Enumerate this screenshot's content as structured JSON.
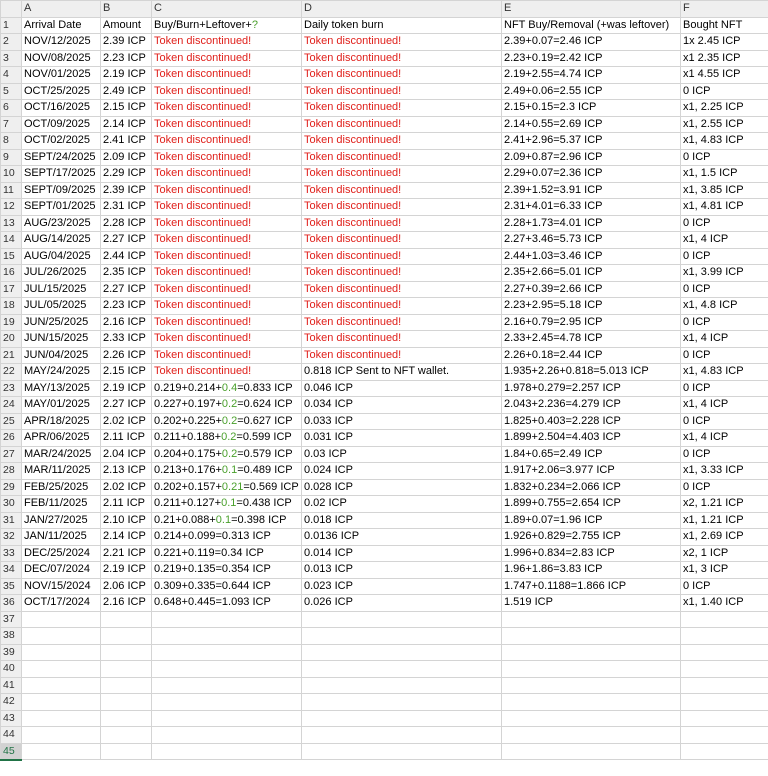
{
  "colors": {
    "discontinued": "#e0201b",
    "highlight_number": "#4aa02c",
    "active_row_header": "#217346"
  },
  "columns": [
    "A",
    "B",
    "C",
    "D",
    "E",
    "F"
  ],
  "headers": {
    "a": "Arrival Date",
    "b": "Amount",
    "c_pre": "Buy/Burn+Leftover+",
    "c_q": "?",
    "d": "Daily token burn",
    "e": "NFT Buy/Removal (+was leftover)",
    "f": "Bought NFT"
  },
  "rows": [
    {
      "a": "NOV/12/2025",
      "b": "2.39 ICP",
      "c": "Token discontinued!",
      "c_red": true,
      "d": "Token discontinued!",
      "d_red": true,
      "e": "2.39+0.07=2.46 ICP",
      "f": "1x 2.45 ICP"
    },
    {
      "a": "NOV/08/2025",
      "b": "2.23 ICP",
      "c": "Token discontinued!",
      "c_red": true,
      "d": "Token discontinued!",
      "d_red": true,
      "e": "2.23+0.19=2.42 ICP",
      "f": "x1 2.35 ICP"
    },
    {
      "a": "NOV/01/2025",
      "b": "2.19 ICP",
      "c": "Token discontinued!",
      "c_red": true,
      "d": "Token discontinued!",
      "d_red": true,
      "e": "2.19+2.55=4.74 ICP",
      "f": "x1 4.55 ICP"
    },
    {
      "a": "OCT/25/2025",
      "b": "2.49 ICP",
      "c": "Token discontinued!",
      "c_red": true,
      "d": "Token discontinued!",
      "d_red": true,
      "e": "2.49+0.06=2.55 ICP",
      "f": "0 ICP"
    },
    {
      "a": "OCT/16/2025",
      "b": "2.15 ICP",
      "c": "Token discontinued!",
      "c_red": true,
      "d": "Token discontinued!",
      "d_red": true,
      "e": "2.15+0.15=2.3 ICP",
      "f": "x1, 2.25 ICP"
    },
    {
      "a": "OCT/09/2025",
      "b": "2.14 ICP",
      "c": "Token discontinued!",
      "c_red": true,
      "d": "Token discontinued!",
      "d_red": true,
      "e": "2.14+0.55=2.69 ICP",
      "f": "x1, 2.55 ICP"
    },
    {
      "a": "OCT/02/2025",
      "b": "2.41 ICP",
      "c": "Token discontinued!",
      "c_red": true,
      "d": "Token discontinued!",
      "d_red": true,
      "e": "2.41+2.96=5.37 ICP",
      "f": "x1, 4.83 ICP"
    },
    {
      "a": "SEPT/24/2025",
      "b": "2.09 ICP",
      "c": "Token discontinued!",
      "c_red": true,
      "d": "Token discontinued!",
      "d_red": true,
      "e": "2.09+0.87=2.96 ICP",
      "f": "0 ICP"
    },
    {
      "a": "SEPT/17/2025",
      "b": "2.29 ICP",
      "c": "Token discontinued!",
      "c_red": true,
      "d": "Token discontinued!",
      "d_red": true,
      "e": "2.29+0.07=2.36 ICP",
      "f": "x1, 1.5 ICP"
    },
    {
      "a": "SEPT/09/2025",
      "b": "2.39 ICP",
      "c": "Token discontinued!",
      "c_red": true,
      "d": "Token discontinued!",
      "d_red": true,
      "e": "2.39+1.52=3.91 ICP",
      "f": "x1, 3.85 ICP"
    },
    {
      "a": "SEPT/01/2025",
      "b": "2.31 ICP",
      "c": "Token discontinued!",
      "c_red": true,
      "d": "Token discontinued!",
      "d_red": true,
      "e": "2.31+4.01=6.33 ICP",
      "f": "x1, 4.81 ICP"
    },
    {
      "a": "AUG/23/2025",
      "b": "2.28 ICP",
      "c": "Token discontinued!",
      "c_red": true,
      "d": "Token discontinued!",
      "d_red": true,
      "e": "2.28+1.73=4.01 ICP",
      "f": "0 ICP"
    },
    {
      "a": "AUG/14/2025",
      "b": "2.27 ICP",
      "c": "Token discontinued!",
      "c_red": true,
      "d": "Token discontinued!",
      "d_red": true,
      "e": "2.27+3.46=5.73 ICP",
      "f": "x1, 4 ICP"
    },
    {
      "a": "AUG/04/2025",
      "b": "2.44 ICP",
      "c": "Token discontinued!",
      "c_red": true,
      "d": "Token discontinued!",
      "d_red": true,
      "e": "2.44+1.03=3.46 ICP",
      "f": "0 ICP"
    },
    {
      "a": "JUL/26/2025",
      "b": "2.35 ICP",
      "c": "Token discontinued!",
      "c_red": true,
      "d": "Token discontinued!",
      "d_red": true,
      "e": "2.35+2.66=5.01 ICP",
      "f": "x1, 3.99 ICP"
    },
    {
      "a": "JUL/15/2025",
      "b": "2.27 ICP",
      "c": "Token discontinued!",
      "c_red": true,
      "d": "Token discontinued!",
      "d_red": true,
      "e": "2.27+0.39=2.66 ICP",
      "f": "0 ICP"
    },
    {
      "a": "JUL/05/2025",
      "b": "2.23 ICP",
      "c": "Token discontinued!",
      "c_red": true,
      "d": "Token discontinued!",
      "d_red": true,
      "e": "2.23+2.95=5.18 ICP",
      "f": "x1, 4.8 ICP"
    },
    {
      "a": "JUN/25/2025",
      "b": "2.16 ICP",
      "c": "Token discontinued!",
      "c_red": true,
      "d": "Token discontinued!",
      "d_red": true,
      "e": "2.16+0.79=2.95 ICP",
      "f": "0 ICP"
    },
    {
      "a": "JUN/15/2025",
      "b": "2.33 ICP",
      "c": "Token discontinued!",
      "c_red": true,
      "d": "Token discontinued!",
      "d_red": true,
      "e": "2.33+2.45=4.78 ICP",
      "f": "x1, 4 ICP"
    },
    {
      "a": "JUN/04/2025",
      "b": "2.26 ICP",
      "c": "Token discontinued!",
      "c_red": true,
      "d": "Token discontinued!",
      "d_red": true,
      "e": "2.26+0.18=2.44 ICP",
      "f": "0 ICP"
    },
    {
      "a": "MAY/24/2025",
      "b": "2.15 ICP",
      "c": "Token discontinued!",
      "c_red": true,
      "d": "0.818 ICP Sent to NFT wallet.",
      "e": "1.935+2.26+0.818=5.013 ICP",
      "f": "x1, 4.83 ICP"
    },
    {
      "a": "MAY/13/2025",
      "b": "2.19 ICP",
      "c_parts": [
        "0.219+0.214+",
        "0.4",
        "=0.833 ICP"
      ],
      "d": "0.046 ICP",
      "e": "1.978+0.279=2.257 ICP",
      "f": "0 ICP"
    },
    {
      "a": "MAY/01/2025",
      "b": "2.27 ICP",
      "c_parts": [
        "0.227+0.197+",
        "0.2",
        "=0.624 ICP"
      ],
      "d": "0.034 ICP",
      "e": "2.043+2.236=4.279 ICP",
      "f": "x1, 4 ICP"
    },
    {
      "a": "APR/18/2025",
      "b": "2.02 ICP",
      "c_parts": [
        "0.202+0.225+",
        "0.2",
        "=0.627 ICP"
      ],
      "d": "0.033 ICP",
      "e": "1.825+0.403=2.228 ICP",
      "f": "0 ICP"
    },
    {
      "a": "APR/06/2025",
      "b": "2.11 ICP",
      "c_parts": [
        "0.211+0.188+",
        "0.2",
        "=0.599 ICP"
      ],
      "d": "0.031 ICP",
      "e": "1.899+2.504=4.403 ICP",
      "f": "x1, 4 ICP"
    },
    {
      "a": "MAR/24/2025",
      "b": "2.04 ICP",
      "c_parts": [
        "0.204+0.175+",
        "0.2",
        "=0.579 ICP"
      ],
      "d": "0.03 ICP",
      "e": "1.84+0.65=2.49 ICP",
      "f": "0 ICP"
    },
    {
      "a": "MAR/11/2025",
      "b": "2.13 ICP",
      "c_parts": [
        "0.213+0.176+",
        "0.1",
        "=0.489 ICP"
      ],
      "d": "0.024 ICP",
      "e": "1.917+2.06=3.977 ICP",
      "f": "x1, 3.33 ICP"
    },
    {
      "a": "FEB/25/2025",
      "b": "2.02 ICP",
      "c_parts": [
        "0.202+0.157+",
        "0.21",
        "=0.569 ICP"
      ],
      "d": "0.028 ICP",
      "e": "1.832+0.234=2.066 ICP",
      "f": "0 ICP"
    },
    {
      "a": "FEB/11/2025",
      "b": "2.11 ICP",
      "c_parts": [
        "0.211+0.127+",
        "0.1",
        "=0.438 ICP"
      ],
      "d": "0.02 ICP",
      "e": "1.899+0.755=2.654 ICP",
      "f": "x2, 1.21 ICP"
    },
    {
      "a": "JAN/27/2025",
      "b": "2.10 ICP",
      "c_parts": [
        "0.21+0.088+",
        "0.1",
        "=0.398 ICP"
      ],
      "d": "0.018 ICP",
      "e": "1.89+0.07=1.96 ICP",
      "f": "x1, 1.21 ICP"
    },
    {
      "a": "JAN/11/2025",
      "b": "2.14 ICP",
      "c": "0.214+0.099=0.313 ICP",
      "d": "0.0136 ICP",
      "e": "1.926+0.829=2.755 ICP",
      "f": "x1, 2.69 ICP"
    },
    {
      "a": "DEC/25/2024",
      "b": "2.21 ICP",
      "c": "0.221+0.119=0.34 ICP",
      "d": "0.014 ICP",
      "e": "1.996+0.834=2.83 ICP",
      "f": "x2, 1 ICP"
    },
    {
      "a": "DEC/07/2024",
      "b": "2.19 ICP",
      "c": "0.219+0.135=0.354 ICP",
      "d": "0.013 ICP",
      "e": "1.96+1.86=3.83 ICP",
      "f": "x1, 3 ICP"
    },
    {
      "a": "NOV/15/2024",
      "b": "2.06 ICP",
      "c": "0.309+0.335=0.644 ICP",
      "d": "0.023 ICP",
      "e": "1.747+0.1188=1.866 ICP",
      "f": "0 ICP"
    },
    {
      "a": "OCT/17/2024",
      "b": "2.16 ICP",
      "c": "0.648+0.445=1.093 ICP",
      "d": "0.026 ICP",
      "e": "1.519 ICP",
      "f": "x1, 1.40 ICP"
    }
  ],
  "total_row_count": 45,
  "active_row": 45
}
